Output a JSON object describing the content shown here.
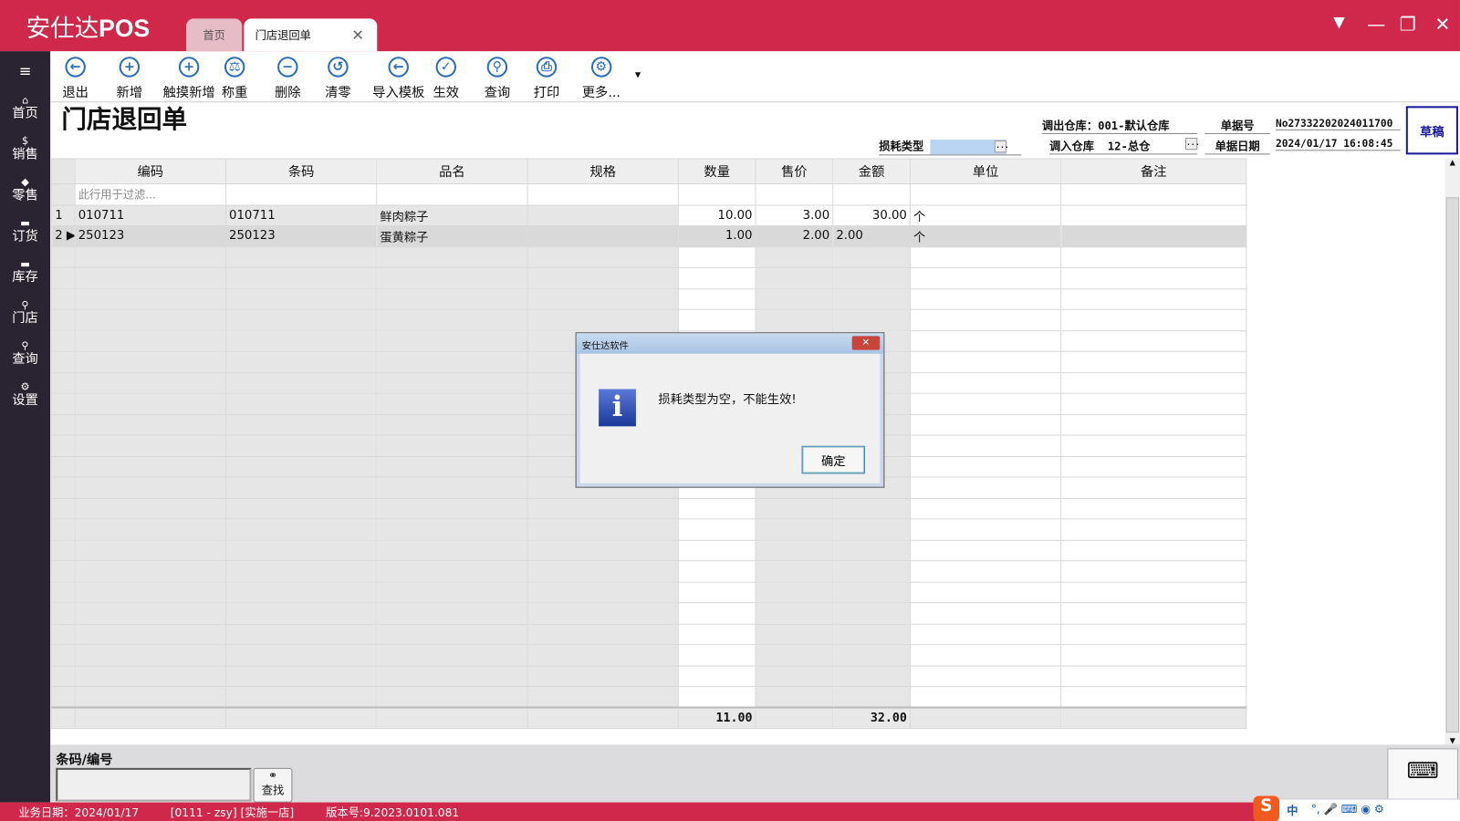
{
  "app": {
    "logo_cn": "安仕达",
    "logo_en": "POS"
  },
  "tabs": [
    {
      "label": "首页"
    },
    {
      "label": "门店退回单"
    }
  ],
  "window": {
    "dropdown": "▼",
    "minimize": "—",
    "restore": "❐",
    "close": "✕"
  },
  "sidebar": [
    {
      "icon": "⌂",
      "label": "首页"
    },
    {
      "icon": "$",
      "label": "销售"
    },
    {
      "icon": "◆",
      "label": "零售"
    },
    {
      "icon": "▬",
      "label": "订货"
    },
    {
      "icon": "▬",
      "label": "库存"
    },
    {
      "icon": "⚲",
      "label": "门店"
    },
    {
      "icon": "⚲",
      "label": "查询"
    },
    {
      "icon": "⚙",
      "label": "设置"
    }
  ],
  "toolbar": [
    {
      "icon": "←",
      "label": "退出"
    },
    {
      "icon": "+",
      "label": "新增"
    },
    {
      "icon": "+",
      "label": "触摸新增"
    },
    {
      "icon": "⚖",
      "label": "称重"
    },
    {
      "icon": "−",
      "label": "删除"
    },
    {
      "icon": "↺",
      "label": "清零"
    },
    {
      "icon": "←",
      "label": "导入模板"
    },
    {
      "icon": "✓",
      "label": "生效"
    },
    {
      "icon": "⚲",
      "label": "查询"
    },
    {
      "icon": "⎙",
      "label": "打印"
    },
    {
      "icon": "⚙",
      "label": "更多..."
    }
  ],
  "page_title": "门店退回单",
  "header": {
    "loss_type_label": "损耗类型",
    "loss_type_value": "",
    "out_wh_label": "调出仓库：",
    "out_wh_value": "001-默认仓库",
    "in_wh_label": "调入仓库",
    "in_wh_value": "12-总仓",
    "doc_no_label": "单据号",
    "doc_no_value": "No27332202024011700",
    "doc_date_label": "单据日期",
    "doc_date_value": "2024/01/17 16:08:45",
    "status": "草稿"
  },
  "grid": {
    "columns": [
      "编码",
      "条码",
      "品名",
      "规格",
      "数量",
      "售价",
      "金额",
      "单位",
      "备注"
    ],
    "filter_placeholder": "此行用于过滤...",
    "rows": [
      {
        "n": "1",
        "code": "010711",
        "barcode": "010711",
        "name": "鲜肉粽子",
        "spec": "",
        "qty": "10.00",
        "price": "3.00",
        "amount": "30.00",
        "unit": "个",
        "note": ""
      },
      {
        "n": "2",
        "code": "250123",
        "barcode": "250123",
        "name": "蛋黄粽子",
        "spec": "",
        "qty": "1.00",
        "price": "2.00",
        "amount": "2.00",
        "unit": "个",
        "note": ""
      }
    ],
    "totals": {
      "qty": "11.00",
      "amount": "32.00"
    }
  },
  "bottom": {
    "barcode_label": "条码/编号",
    "barcode_value": "",
    "find_label": "查找"
  },
  "status": {
    "biz_date": "业务日期：2024/01/17",
    "user": "[0111 - zsy]  [实施一店]",
    "version": "版本号:9.2023.0101.081"
  },
  "ime": {
    "lang": "中"
  },
  "dialog": {
    "title": "安仕达软件",
    "message": "损耗类型为空，不能生效!",
    "ok": "确定",
    "icon": "i"
  }
}
